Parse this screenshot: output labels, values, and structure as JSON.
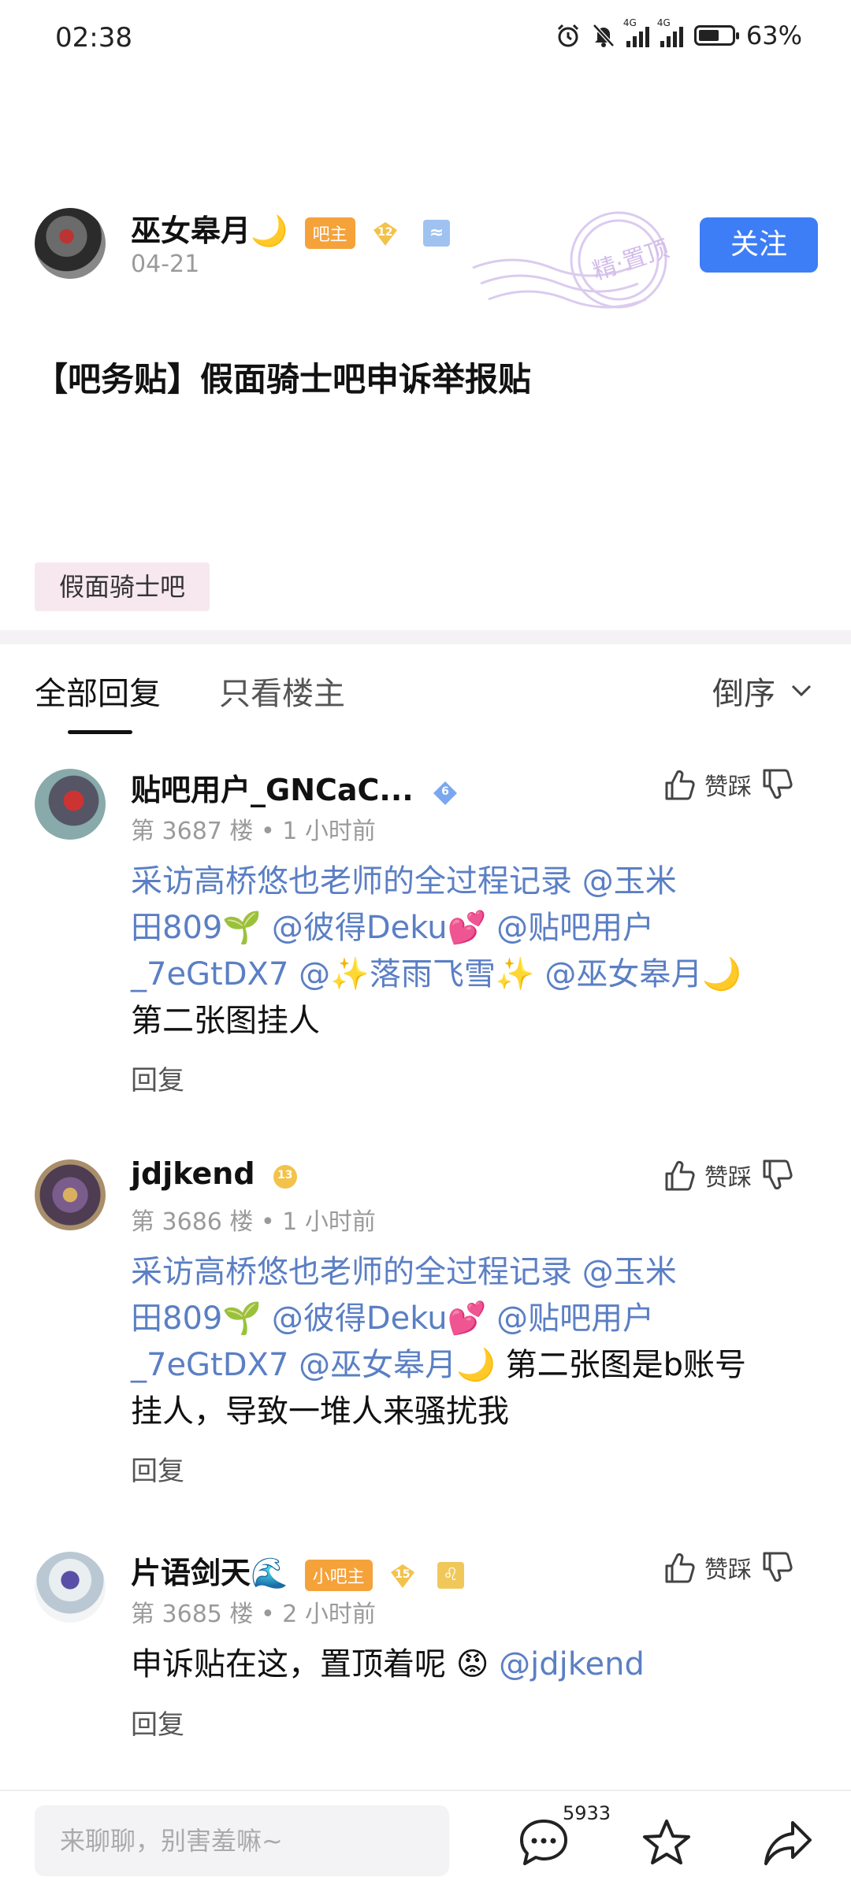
{
  "status_bar": {
    "time": "02:38",
    "battery_percent": "63%",
    "battery_level": 0.63,
    "signal_label_1": "4G",
    "signal_label_2": "4G"
  },
  "post": {
    "author": {
      "name": "巫女皋月🌙",
      "role_badge": "吧主",
      "level": "12",
      "date": "04-21"
    },
    "follow_label": "关注",
    "stamp_text": "精·置顶",
    "title": "【吧务贴】假面骑士吧申诉举报贴",
    "forum_tag": "假面骑士吧"
  },
  "tabs": {
    "all": "全部回复",
    "op_only": "只看楼主",
    "sort": "倒序"
  },
  "replies": [
    {
      "name": "贴吧用户_GNCaC...",
      "level": "6",
      "floor": "第 3687 楼",
      "time": "1 小时前",
      "vote_label": "赞踩",
      "mentions_line1": "采访高桥悠也老师的全过程记录 @玉米",
      "mentions_line2": "田809🌱  @彼得Deku💕  @贴吧用户",
      "mentions_line3": "_7eGtDX7  @✨落雨飞雪✨  @巫女皋月🌙",
      "text_line4": "第二张图挂人",
      "reply_label": "回复"
    },
    {
      "name": "jdjkend",
      "level": "13",
      "floor": "第 3686 楼",
      "time": "1 小时前",
      "vote_label": "赞踩",
      "mentions_line1": "采访高桥悠也老师的全过程记录 @玉米",
      "mentions_line2": "田809🌱  @彼得Deku💕  @贴吧用户",
      "mentions_line3": "_7eGtDX7  @巫女皋月🌙",
      "text_line3_tail": " 第二张图是b账号",
      "text_line4": "挂人，导致一堆人来骚扰我",
      "reply_label": "回复"
    },
    {
      "name": "片语剑天🌊",
      "role_badge": "小吧主",
      "level": "15",
      "floor": "第 3685 楼",
      "time": "2 小时前",
      "vote_label": "赞踩",
      "text": "申诉贴在这，置顶着呢",
      "emoji": "😡",
      "mention": "@jdjkend",
      "reply_label": "回复"
    }
  ],
  "bottom_bar": {
    "input_placeholder": "来聊聊，别害羞嘛~",
    "comment_count": "5933"
  },
  "colors": {
    "accent": "#3d7ef6",
    "mention": "#5b7fc4",
    "role_badge": "#f5a23a",
    "tag_bg": "#f7e8ef"
  }
}
